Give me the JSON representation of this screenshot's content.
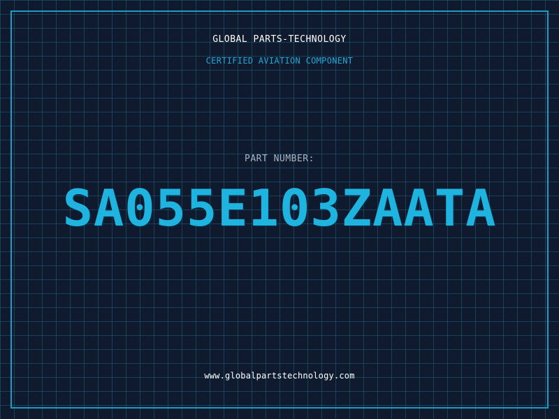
{
  "header": {
    "company": "GLOBAL PARTS-TECHNOLOGY",
    "subtitle": "CERTIFIED AVIATION COMPONENT"
  },
  "part": {
    "label": "PART NUMBER:",
    "number": "SA055E103ZAATA"
  },
  "footer": {
    "website": "www.globalpartstechnology.com"
  },
  "colors": {
    "background": "#0f1a2e",
    "grid": "#286e8c",
    "frame": "#1e9cc4",
    "accent": "#1fb4e0",
    "label": "#a8b4c4",
    "text": "#ffffff"
  }
}
